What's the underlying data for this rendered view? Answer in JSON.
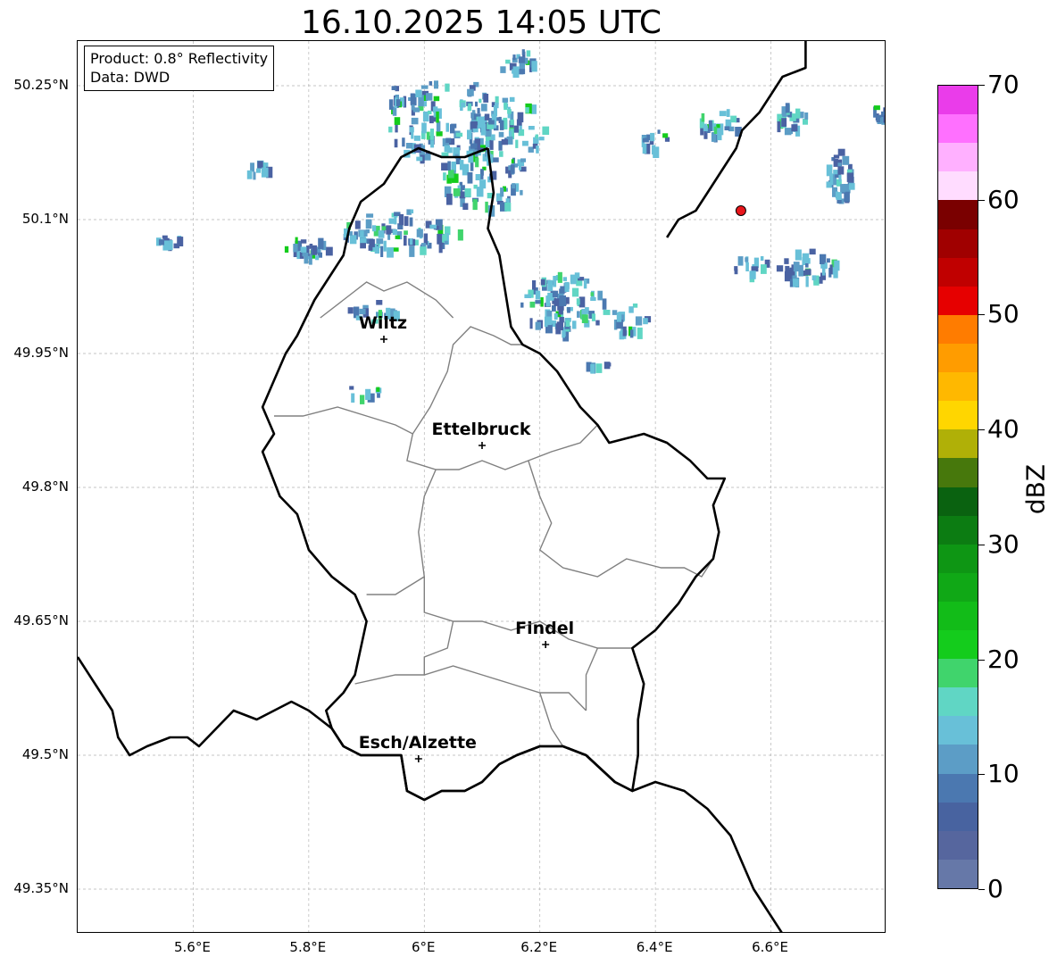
{
  "title": "16.10.2025 14:05 UTC",
  "info": {
    "product": "Product: 0.8° Reflectivity",
    "source": "Data: DWD"
  },
  "extent": {
    "lon_min": 5.4,
    "lon_max": 6.8,
    "lat_min": 49.3,
    "lat_max": 50.3
  },
  "y_ticks": [
    {
      "lat": 50.25,
      "label": "50.25°N"
    },
    {
      "lat": 50.1,
      "label": "50.1°N"
    },
    {
      "lat": 49.95,
      "label": "49.95°N"
    },
    {
      "lat": 49.8,
      "label": "49.8°N"
    },
    {
      "lat": 49.65,
      "label": "49.65°N"
    },
    {
      "lat": 49.5,
      "label": "49.5°N"
    },
    {
      "lat": 49.35,
      "label": "49.35°N"
    }
  ],
  "x_ticks": [
    {
      "lon": 5.6,
      "label": "5.6°E"
    },
    {
      "lon": 5.8,
      "label": "5.8°E"
    },
    {
      "lon": 6.0,
      "label": "6°E"
    },
    {
      "lon": 6.2,
      "label": "6.2°E"
    },
    {
      "lon": 6.4,
      "label": "6.4°E"
    },
    {
      "lon": 6.6,
      "label": "6.6°E"
    }
  ],
  "cities": [
    {
      "name": "Wiltz",
      "lon": 5.93,
      "lat": 49.966
    },
    {
      "name": "Ettelbruck",
      "lon": 6.1,
      "lat": 49.847
    },
    {
      "name": "Findel",
      "lon": 6.21,
      "lat": 49.624
    },
    {
      "name": "Esch/Alzette",
      "lon": 5.99,
      "lat": 49.496
    }
  ],
  "radar_site": {
    "lon": 6.548,
    "lat": 50.11,
    "color": "#e8161b"
  },
  "colorbar": {
    "label": "dBZ",
    "min": 0,
    "max": 70,
    "ticks": [
      0,
      10,
      20,
      30,
      40,
      50,
      60,
      70
    ],
    "colors": [
      "#6678a8",
      "#56669e",
      "#4863a0",
      "#4b78b0",
      "#5c9dc6",
      "#68c0d8",
      "#60d6c4",
      "#40d46c",
      "#14cc1c",
      "#12bc18",
      "#10a816",
      "#0e9614",
      "#0c7c12",
      "#0a6210",
      "#47780c",
      "#b0b007",
      "#ffd600",
      "#ffb800",
      "#ff9c00",
      "#ff7c00",
      "#e60000",
      "#c00000",
      "#a00000",
      "#7a0000",
      "#ffdcff",
      "#ffb0ff",
      "#ff70ff",
      "#ea3cea"
    ]
  },
  "styles": {
    "border_color": "#000000",
    "canton_color": "#808080",
    "grid_color": "#b4b4b4",
    "cell_colors": [
      "#4a62a2",
      "#4b78b0",
      "#5c9dc6",
      "#68c0d8",
      "#60d6c4",
      "#40d46c",
      "#14cc1c"
    ]
  },
  "map_features": {
    "national_borders": [
      [
        [
          5.4,
          49.61
        ],
        [
          5.43,
          49.58
        ],
        [
          5.46,
          49.55
        ],
        [
          5.47,
          49.52
        ],
        [
          5.49,
          49.5
        ],
        [
          5.52,
          49.51
        ],
        [
          5.56,
          49.52
        ],
        [
          5.59,
          49.52
        ],
        [
          5.61,
          49.51
        ],
        [
          5.64,
          49.53
        ],
        [
          5.67,
          49.55
        ],
        [
          5.71,
          49.54
        ],
        [
          5.74,
          49.55
        ],
        [
          5.77,
          49.56
        ],
        [
          5.8,
          49.55
        ],
        [
          5.82,
          49.54
        ],
        [
          5.84,
          49.53
        ],
        [
          5.86,
          49.51
        ],
        [
          5.89,
          49.5
        ],
        [
          5.93,
          49.5
        ],
        [
          5.96,
          49.5
        ],
        [
          5.97,
          49.46
        ],
        [
          6.0,
          49.45
        ],
        [
          6.03,
          49.46
        ],
        [
          6.07,
          49.46
        ],
        [
          6.1,
          49.47
        ],
        [
          6.13,
          49.49
        ],
        [
          6.16,
          49.5
        ],
        [
          6.2,
          49.51
        ],
        [
          6.24,
          49.51
        ],
        [
          6.28,
          49.5
        ],
        [
          6.33,
          49.47
        ],
        [
          6.36,
          49.46
        ],
        [
          6.4,
          49.47
        ],
        [
          6.45,
          49.46
        ],
        [
          6.49,
          49.44
        ],
        [
          6.53,
          49.41
        ],
        [
          6.55,
          49.38
        ],
        [
          6.57,
          49.35
        ],
        [
          6.59,
          49.33
        ],
        [
          6.62,
          49.3
        ]
      ],
      [
        [
          6.66,
          50.3
        ],
        [
          6.66,
          50.27
        ],
        [
          6.62,
          50.26
        ],
        [
          6.6,
          50.24
        ],
        [
          6.58,
          50.22
        ],
        [
          6.55,
          50.2
        ],
        [
          6.54,
          50.18
        ],
        [
          6.51,
          50.15
        ],
        [
          6.49,
          50.13
        ],
        [
          6.47,
          50.11
        ],
        [
          6.44,
          50.1
        ],
        [
          6.42,
          50.08
        ]
      ]
    ],
    "lux_border": [
      [
        6.11,
        50.18
      ],
      [
        6.07,
        50.17
      ],
      [
        6.03,
        50.17
      ],
      [
        5.99,
        50.18
      ],
      [
        5.96,
        50.17
      ],
      [
        5.93,
        50.14
      ],
      [
        5.89,
        50.12
      ],
      [
        5.87,
        50.09
      ],
      [
        5.86,
        50.06
      ],
      [
        5.84,
        50.04
      ],
      [
        5.81,
        50.01
      ],
      [
        5.78,
        49.97
      ],
      [
        5.76,
        49.95
      ],
      [
        5.74,
        49.92
      ],
      [
        5.72,
        49.89
      ],
      [
        5.74,
        49.86
      ],
      [
        5.72,
        49.84
      ],
      [
        5.75,
        49.79
      ],
      [
        5.78,
        49.77
      ],
      [
        5.8,
        49.73
      ],
      [
        5.84,
        49.7
      ],
      [
        5.88,
        49.68
      ],
      [
        5.9,
        49.65
      ],
      [
        5.89,
        49.62
      ],
      [
        5.88,
        49.59
      ],
      [
        5.86,
        49.57
      ],
      [
        5.83,
        49.55
      ],
      [
        5.84,
        49.53
      ],
      [
        5.86,
        49.51
      ],
      [
        5.89,
        49.5
      ],
      [
        5.93,
        49.5
      ],
      [
        5.96,
        49.5
      ],
      [
        5.97,
        49.46
      ],
      [
        6.0,
        49.45
      ],
      [
        6.03,
        49.46
      ],
      [
        6.07,
        49.46
      ],
      [
        6.1,
        49.47
      ],
      [
        6.13,
        49.49
      ],
      [
        6.16,
        49.5
      ],
      [
        6.2,
        49.51
      ],
      [
        6.24,
        49.51
      ],
      [
        6.28,
        49.5
      ],
      [
        6.33,
        49.47
      ],
      [
        6.36,
        49.46
      ],
      [
        6.37,
        49.5
      ],
      [
        6.37,
        49.54
      ],
      [
        6.38,
        49.58
      ],
      [
        6.36,
        49.62
      ],
      [
        6.4,
        49.64
      ],
      [
        6.44,
        49.67
      ],
      [
        6.47,
        49.7
      ],
      [
        6.5,
        49.72
      ],
      [
        6.51,
        49.75
      ],
      [
        6.5,
        49.78
      ],
      [
        6.52,
        49.81
      ],
      [
        6.49,
        49.81
      ],
      [
        6.46,
        49.83
      ],
      [
        6.42,
        49.85
      ],
      [
        6.38,
        49.86
      ],
      [
        6.32,
        49.85
      ],
      [
        6.3,
        49.87
      ],
      [
        6.27,
        49.89
      ],
      [
        6.23,
        49.93
      ],
      [
        6.2,
        49.95
      ],
      [
        6.17,
        49.96
      ],
      [
        6.15,
        49.98
      ],
      [
        6.14,
        50.02
      ],
      [
        6.13,
        50.06
      ],
      [
        6.11,
        50.09
      ],
      [
        6.12,
        50.13
      ],
      [
        6.11,
        50.18
      ]
    ],
    "cantons": [
      [
        [
          5.74,
          49.88
        ],
        [
          5.79,
          49.88
        ],
        [
          5.85,
          49.89
        ],
        [
          5.9,
          49.88
        ],
        [
          5.95,
          49.87
        ],
        [
          5.98,
          49.86
        ],
        [
          6.01,
          49.89
        ],
        [
          6.04,
          49.93
        ],
        [
          6.05,
          49.96
        ],
        [
          6.08,
          49.98
        ],
        [
          6.12,
          49.97
        ],
        [
          6.15,
          49.96
        ],
        [
          6.17,
          49.96
        ]
      ],
      [
        [
          5.82,
          49.99
        ],
        [
          5.86,
          50.01
        ],
        [
          5.9,
          50.03
        ],
        [
          5.93,
          50.02
        ],
        [
          5.97,
          50.03
        ],
        [
          6.02,
          50.01
        ],
        [
          6.05,
          49.99
        ]
      ],
      [
        [
          5.98,
          49.86
        ],
        [
          5.97,
          49.83
        ],
        [
          6.02,
          49.82
        ],
        [
          6.06,
          49.82
        ],
        [
          6.1,
          49.83
        ],
        [
          6.14,
          49.82
        ],
        [
          6.18,
          49.83
        ],
        [
          6.22,
          49.84
        ],
        [
          6.27,
          49.85
        ],
        [
          6.3,
          49.87
        ]
      ],
      [
        [
          6.02,
          49.82
        ],
        [
          6.0,
          49.79
        ],
        [
          5.99,
          49.75
        ],
        [
          6.0,
          49.7
        ],
        [
          6.0,
          49.66
        ],
        [
          6.05,
          49.65
        ],
        [
          6.1,
          49.65
        ],
        [
          6.15,
          49.64
        ],
        [
          6.2,
          49.65
        ],
        [
          6.25,
          49.63
        ],
        [
          6.3,
          49.62
        ],
        [
          6.33,
          49.62
        ],
        [
          6.36,
          49.62
        ]
      ],
      [
        [
          6.18,
          49.83
        ],
        [
          6.2,
          49.79
        ],
        [
          6.22,
          49.76
        ],
        [
          6.2,
          49.73
        ],
        [
          6.24,
          49.71
        ],
        [
          6.3,
          49.7
        ],
        [
          6.35,
          49.72
        ],
        [
          6.41,
          49.71
        ],
        [
          6.45,
          49.71
        ],
        [
          6.48,
          49.7
        ],
        [
          6.5,
          49.72
        ]
      ],
      [
        [
          6.0,
          49.7
        ],
        [
          5.95,
          49.68
        ],
        [
          5.9,
          49.68
        ]
      ],
      [
        [
          5.88,
          49.58
        ],
        [
          5.95,
          49.59
        ],
        [
          6.0,
          49.59
        ],
        [
          6.05,
          49.6
        ],
        [
          6.1,
          49.59
        ],
        [
          6.15,
          49.58
        ],
        [
          6.2,
          49.57
        ],
        [
          6.25,
          49.57
        ],
        [
          6.28,
          49.55
        ]
      ],
      [
        [
          6.05,
          49.65
        ],
        [
          6.04,
          49.62
        ],
        [
          6.0,
          49.61
        ],
        [
          6.0,
          49.59
        ]
      ],
      [
        [
          6.2,
          49.57
        ],
        [
          6.22,
          49.53
        ],
        [
          6.24,
          49.51
        ]
      ],
      [
        [
          6.28,
          49.55
        ],
        [
          6.28,
          49.59
        ],
        [
          6.3,
          49.62
        ]
      ]
    ]
  }
}
